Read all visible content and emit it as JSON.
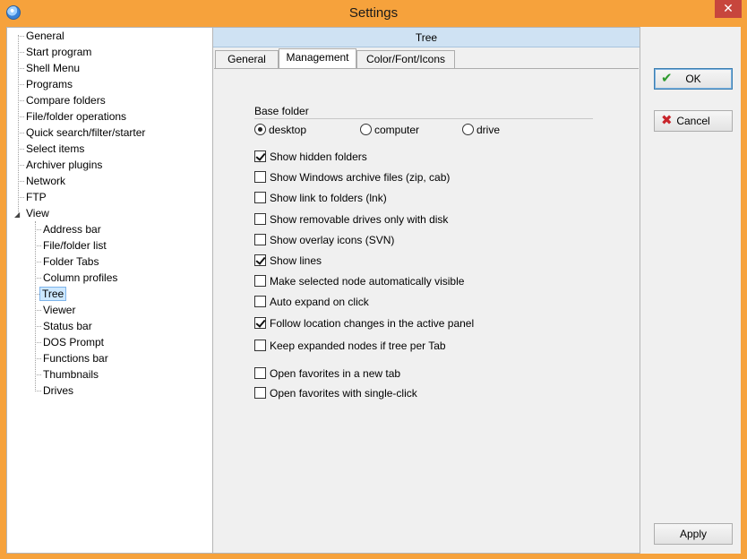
{
  "window": {
    "title": "Settings",
    "close_glyph": "✕"
  },
  "sidebar": {
    "items": [
      {
        "label": "General"
      },
      {
        "label": "Start program"
      },
      {
        "label": "Shell Menu"
      },
      {
        "label": "Programs"
      },
      {
        "label": "Compare folders"
      },
      {
        "label": "File/folder operations"
      },
      {
        "label": "Quick search/filter/starter"
      },
      {
        "label": "Select items"
      },
      {
        "label": "Archiver plugins"
      },
      {
        "label": "Network"
      },
      {
        "label": "FTP"
      },
      {
        "label": "View",
        "expanded": true
      },
      {
        "label": "Address bar"
      },
      {
        "label": "File/folder list"
      },
      {
        "label": "Folder Tabs"
      },
      {
        "label": "Column profiles"
      },
      {
        "label": "Tree",
        "selected": true
      },
      {
        "label": "Viewer"
      },
      {
        "label": "Status bar"
      },
      {
        "label": "DOS Prompt"
      },
      {
        "label": "Functions bar"
      },
      {
        "label": "Thumbnails"
      },
      {
        "label": "Drives"
      }
    ]
  },
  "panel": {
    "header": "Tree",
    "tabs": [
      {
        "label": "General"
      },
      {
        "label": "Management",
        "active": true
      },
      {
        "label": "Color/Font/Icons"
      }
    ],
    "base_folder": {
      "label": "Base folder",
      "options": [
        {
          "label": "desktop",
          "selected": true
        },
        {
          "label": "computer",
          "selected": false
        },
        {
          "label": "drive",
          "selected": false
        }
      ]
    },
    "options": [
      {
        "label": "Show hidden folders",
        "checked": true
      },
      {
        "label": "Show Windows archive files (zip, cab)",
        "checked": false
      },
      {
        "label": "Show link to folders (lnk)",
        "checked": false
      },
      {
        "label": "Show removable drives only with disk",
        "checked": false
      },
      {
        "label": "Show overlay icons (SVN)",
        "checked": false
      },
      {
        "label": "Show lines",
        "checked": true
      },
      {
        "label": "Make selected node automatically visible",
        "checked": false
      },
      {
        "label": "Auto expand on click",
        "checked": false
      },
      {
        "label": "Follow location changes in the active panel",
        "checked": true
      },
      {
        "label": "Keep expanded nodes if tree per Tab",
        "checked": false
      },
      {
        "label": "Open favorites in a new tab",
        "checked": false
      },
      {
        "label": "Open favorites with single-click",
        "checked": false
      }
    ]
  },
  "buttons": {
    "ok": "OK",
    "cancel": "Cancel",
    "apply": "Apply"
  },
  "icons": {
    "ok": "checkmark-icon",
    "cancel": "x-icon"
  },
  "colors": {
    "title_bar": "#f6a23c",
    "close_button": "#c7463d",
    "panel_header": "#cfe2f3",
    "selection": "#cde8ff"
  }
}
